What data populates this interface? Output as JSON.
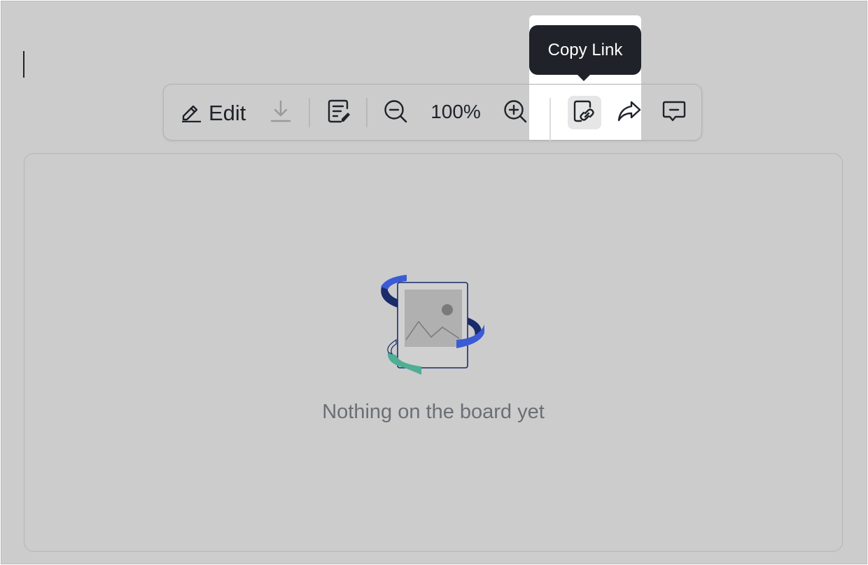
{
  "toolbar": {
    "edit_label": "Edit",
    "zoom_level": "100%"
  },
  "tooltip": {
    "text": "Copy Link"
  },
  "board": {
    "empty_message": "Nothing on the board yet"
  },
  "icons": {
    "edit": "pencil-icon",
    "download": "download-icon",
    "notes": "note-edit-icon",
    "zoom_out": "zoom-out-icon",
    "zoom_in": "zoom-in-icon",
    "copy_link": "copy-link-icon",
    "share": "share-arrow-icon",
    "comment": "comment-icon"
  },
  "colors": {
    "background": "#cccccc",
    "tooltip": "#1f2329",
    "text": "#1f2329",
    "muted_text": "#6b6f75",
    "illustration_blue": "#3b5bd6",
    "illustration_navy": "#1a2b6b",
    "illustration_green": "#4fae95"
  }
}
